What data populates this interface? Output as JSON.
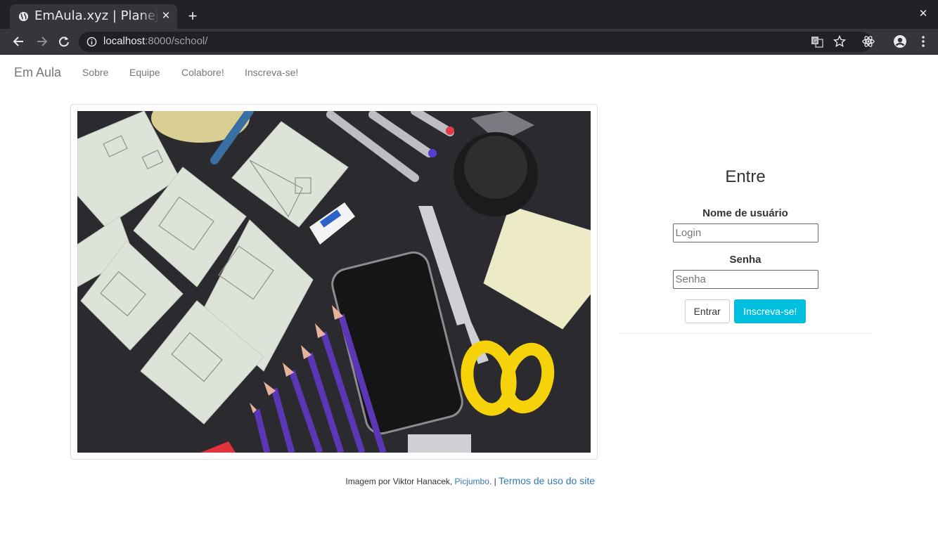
{
  "browser": {
    "tab_title": "EmAula.xyz | Planejamento de aulas",
    "tab_close": "✕",
    "new_tab": "+",
    "window_close": "✕",
    "url_host": "localhost",
    "url_rest": ":8000/school/"
  },
  "navbar": {
    "brand": "Em Aula",
    "links": [
      "Sobre",
      "Equipe",
      "Colabore!",
      "Inscreva-se!"
    ]
  },
  "credit": {
    "prefix": "Imagem por Viktor Hanacek, ",
    "link": "Picjumbo",
    "suffix": ". | ",
    "terms": "Termos de uso do site"
  },
  "login": {
    "title": "Entre",
    "username_label": "Nome de usuário",
    "username_placeholder": "Login",
    "password_label": "Senha",
    "password_placeholder": "Senha",
    "submit_label": "Entrar",
    "signup_label": "Inscreva-se!"
  },
  "colors": {
    "accent": "#00c0e0",
    "link": "#337ab7",
    "chrome_dark": "#202124",
    "chrome_tab": "#35363a"
  }
}
